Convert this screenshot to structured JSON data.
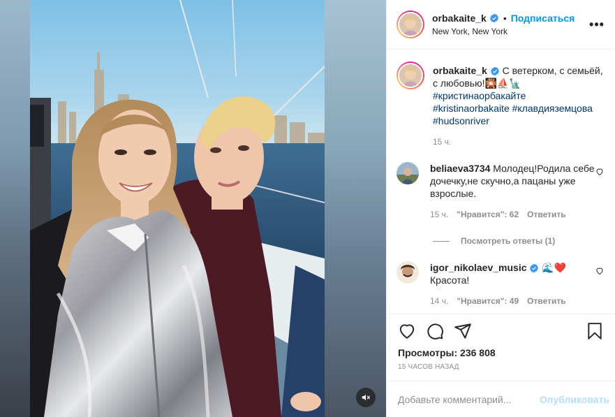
{
  "post": {
    "author": "orbakaite_k",
    "follow_label": "Подписаться",
    "separator": "•",
    "location": "New York, New York",
    "more_label": "•••"
  },
  "caption": {
    "author": "orbakaite_k",
    "text": "С ветерком, с семьёй, с любовью!🎇⛵🗽",
    "hashtags": [
      "#кристинаорбакайте",
      "#kristinaorbakaite",
      "#клавдияземцова",
      "#hudsonriver"
    ],
    "time": "15 ч."
  },
  "comments": [
    {
      "username": "beliaeva3734",
      "text": "Молодец!Родила себе дочечку,не скучно,а пацаны уже взрослые.",
      "time": "15 ч.",
      "likes": "\"Нравится\": 62",
      "reply_label": "Ответить",
      "view_replies": "Посмотреть ответы (1)"
    },
    {
      "username": "igor_nikolaev_music",
      "emoji": "🌊❤️",
      "text": "Красота!",
      "time": "14 ч.",
      "likes": "\"Нравится\": 49",
      "reply_label": "Ответить"
    }
  ],
  "stats": {
    "views": "Просмотры: 236 808",
    "posted_ago": "15 часов назад"
  },
  "comment_input": {
    "placeholder": "Добавьте комментарий...",
    "submit_label": "Опубликовать"
  },
  "colors": {
    "link_blue": "#0095f6",
    "hashtag": "#00376b",
    "muted": "#8e8e8e",
    "disabled_blue": "#b2dffc"
  },
  "icons": [
    "verified-badge-icon",
    "more-options-icon",
    "heart-icon",
    "comment-icon",
    "share-icon",
    "bookmark-icon",
    "sound-muted-icon"
  ]
}
